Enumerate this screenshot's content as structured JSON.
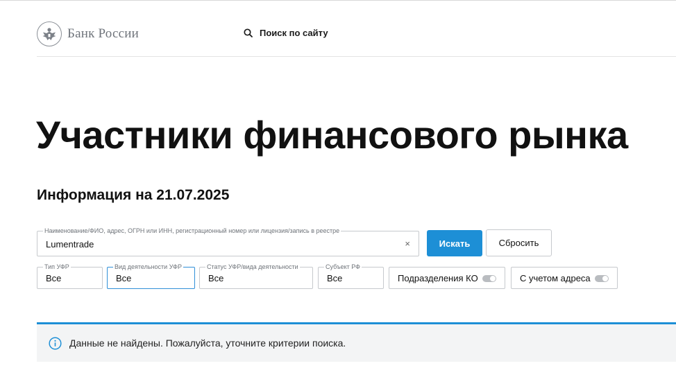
{
  "header": {
    "logo_text": "Банк России",
    "logo_icon": "eagle-emblem-icon",
    "search_label": "Поиск по сайту",
    "search_icon": "search-icon"
  },
  "page": {
    "title": "Участники финансового рынка",
    "info_date": "Информация на 21.07.2025"
  },
  "search": {
    "legend": "Наименование/ФИО, адрес, ОГРН или ИНН, регистрационный номер или лицензия/запись в реестре",
    "value": "Lumentrade",
    "clear_icon": "close-icon",
    "clear_glyph": "×",
    "submit_label": "Искать",
    "reset_label": "Сбросить"
  },
  "filters": {
    "type": {
      "legend": "Тип УФР",
      "value": "Все"
    },
    "activity": {
      "legend": "Вид деятельности УФР",
      "value": "Все"
    },
    "status": {
      "legend": "Статус УФР/вида деятельности",
      "value": "Все"
    },
    "region": {
      "legend": "Субъект РФ",
      "value": "Все"
    },
    "ko_divisions": {
      "label": "Подразделения КО",
      "checked": false
    },
    "with_address": {
      "label": "С учетом адреса",
      "checked": false
    }
  },
  "notice": {
    "icon": "info-icon",
    "text": "Данные не найдены. Пожалуйста, уточните критерии поиска.",
    "accent_color": "#1d8fd6"
  },
  "colors": {
    "primary": "#1d8fd6",
    "border": "#c6c9cd",
    "notice_bg": "#f3f4f5"
  }
}
